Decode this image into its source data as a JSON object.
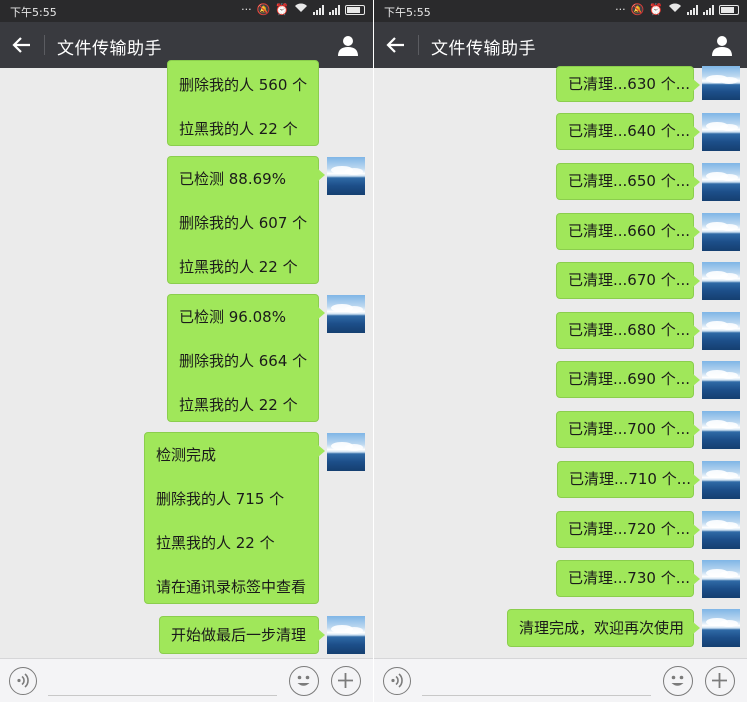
{
  "status": {
    "time": "下午5:55"
  },
  "header": {
    "title": "文件传输助手"
  },
  "left_messages": [
    {
      "lines": [
        "删除我的人 560 个",
        "拉黑我的人 22 个"
      ]
    },
    {
      "lines": [
        "已检测 88.69%",
        "删除我的人 607 个",
        "拉黑我的人 22 个"
      ]
    },
    {
      "lines": [
        "已检测 96.08%",
        "删除我的人 664 个",
        "拉黑我的人 22 个"
      ]
    },
    {
      "lines": [
        "检测完成",
        "删除我的人 715 个",
        "拉黑我的人 22 个",
        "请在通讯录标签中查看"
      ]
    },
    {
      "lines": [
        "开始做最后一步清理"
      ]
    }
  ],
  "right_messages": [
    "已清理...630 个...",
    "已清理...640 个...",
    "已清理...650 个...",
    "已清理...660 个...",
    "已清理...670 个...",
    "已清理...680 个...",
    "已清理...690 个...",
    "已清理...700 个...",
    "已清理...710 个...",
    "已清理...720 个...",
    "已清理...730 个...",
    "清理完成，欢迎再次使用"
  ],
  "icons": {
    "back": "back-arrow-icon",
    "profile": "person-icon",
    "voice": "voice-icon",
    "emoji": "emoji-icon",
    "more": "plus-icon"
  },
  "colors": {
    "header_bg": "#393a3f",
    "status_bg": "#2a2a2c",
    "bubble_bg": "#a0e75a",
    "chat_bg": "#ebebeb"
  }
}
